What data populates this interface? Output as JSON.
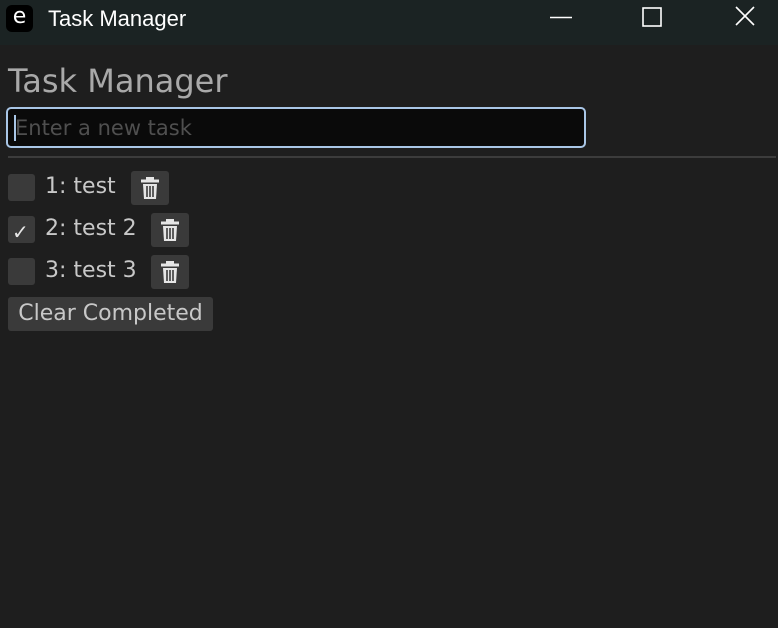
{
  "window": {
    "app_icon_glyph": "e",
    "title": "Task Manager",
    "controls": {
      "minimize_icon": "minimize-icon",
      "maximize_icon": "maximize-icon",
      "close_icon": "close-icon"
    }
  },
  "main": {
    "heading": "Task Manager",
    "input": {
      "value": "",
      "placeholder": "Enter a new task"
    },
    "tasks": [
      {
        "label": "1: test",
        "checked": false,
        "delete_icon": "trash-icon"
      },
      {
        "label": "2: test 2",
        "checked": true,
        "checkmark": "✓",
        "delete_icon": "trash-icon"
      },
      {
        "label": "3: test 3",
        "checked": false,
        "delete_icon": "trash-icon"
      }
    ],
    "clear_button_label": "Clear Completed"
  },
  "colors": {
    "background": "#1e1e1e",
    "titlebar": "#1b2323",
    "input_border": "#a9c6e6",
    "button_bg": "#3a3a3a",
    "text": "#c8c8c8"
  }
}
